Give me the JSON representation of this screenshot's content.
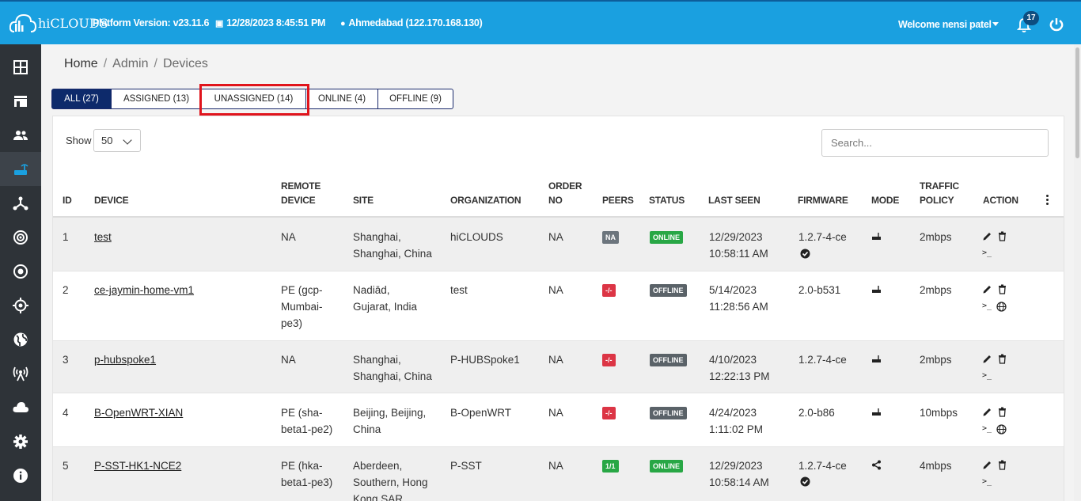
{
  "topbar": {
    "logo_text": "hiCLOUDS",
    "platform_version": "Platform Version: v23.11.6",
    "datetime": "12/28/2023 8:45:51 PM",
    "location": "Ahmedabad (122.170.168.130)",
    "welcome": "Welcome nensi patel",
    "notification_count": "17"
  },
  "sidebar": {
    "items": [
      "dashboard-icon",
      "store-icon",
      "users-icon",
      "router-icon",
      "topology-icon",
      "radar-icon",
      "target-icon",
      "crosshair-icon",
      "globe-icon",
      "antenna-icon",
      "cloud-icon",
      "gear-icon",
      "info-icon"
    ],
    "active_index": 3
  },
  "breadcrumb": {
    "home": "Home",
    "admin": "Admin",
    "current": "Devices"
  },
  "tabs": [
    {
      "label": "ALL (27)",
      "active": true
    },
    {
      "label": "ASSIGNED (13)",
      "active": false
    },
    {
      "label": "UNASSIGNED (14)",
      "active": false
    },
    {
      "label": "ONLINE (4)",
      "active": false
    },
    {
      "label": "OFFLINE (9)",
      "active": false
    }
  ],
  "controls": {
    "show_label": "Show",
    "page_size": "50",
    "search_placeholder": "Search..."
  },
  "table": {
    "headers": {
      "id": "ID",
      "device": "DEVICE",
      "remote_device": [
        "REMOTE",
        "DEVICE"
      ],
      "site": "SITE",
      "organization": "ORGANIZATION",
      "order_no": [
        "ORDER",
        "NO"
      ],
      "peers": "PEERS",
      "status": "STATUS",
      "last_seen": "LAST SEEN",
      "firmware": "FIRMWARE",
      "mode": "MODE",
      "traffic_policy": [
        "TRAFFIC",
        "POLICY"
      ],
      "action": "ACTION"
    },
    "rows": [
      {
        "id": "1",
        "device": "test",
        "remote": [
          "NA"
        ],
        "site": [
          "Shanghai,",
          "Shanghai, China"
        ],
        "org": "hiCLOUDS",
        "order": "NA",
        "peers": "NA",
        "status": "ONLINE",
        "last_seen": [
          "12/29/2023",
          "10:58:11 AM"
        ],
        "firmware": "1.2.7-4-ce",
        "policy": "2mbps"
      },
      {
        "id": "2",
        "device": "ce-jaymin-home-vm1",
        "remote": [
          "PE (gcp-",
          "Mumbai-",
          "pe3)"
        ],
        "site": [
          "Nadiād,",
          "Gujarat, India"
        ],
        "org": "test",
        "order": "NA",
        "peers": "-/-",
        "status": "OFFLINE",
        "last_seen": [
          "5/14/2023",
          "11:28:56 AM"
        ],
        "firmware": "2.0-b531",
        "policy": "2mbps"
      },
      {
        "id": "3",
        "device": "p-hubspoke1",
        "remote": [
          "NA"
        ],
        "site": [
          "Shanghai,",
          "Shanghai, China"
        ],
        "org": "P-HUBSpoke1",
        "order": "NA",
        "peers": "-/-",
        "status": "OFFLINE",
        "last_seen": [
          "4/10/2023",
          "12:22:13 PM"
        ],
        "firmware": "1.2.7-4-ce",
        "policy": "2mbps"
      },
      {
        "id": "4",
        "device": "B-OpenWRT-XIAN",
        "remote": [
          "PE (sha-",
          "beta1-pe2)"
        ],
        "site": [
          "Beijing, Beijing,",
          "China"
        ],
        "org": "B-OpenWRT",
        "order": "NA",
        "peers": "-/-",
        "status": "OFFLINE",
        "last_seen": [
          "4/24/2023",
          "1:11:02 PM"
        ],
        "firmware": "2.0-b86",
        "policy": "10mbps"
      },
      {
        "id": "5",
        "device": "P-SST-HK1-NCE2",
        "remote": [
          "PE (hka-",
          "beta1-pe3)"
        ],
        "site": [
          "Aberdeen,",
          "Southern, Hong",
          "Kong SAR"
        ],
        "org": "P-SST",
        "order": "NA",
        "peers": "1/1",
        "status": "ONLINE",
        "last_seen": [
          "12/29/2023",
          "10:58:14 AM"
        ],
        "firmware": "1.2.7-4-ce",
        "policy": "4mbps"
      }
    ],
    "terminal_glyph": ">_"
  }
}
